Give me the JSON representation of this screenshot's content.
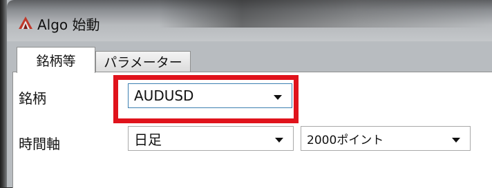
{
  "window": {
    "title": "Algo 始動"
  },
  "tabs": [
    {
      "label": "銘柄等",
      "active": true
    },
    {
      "label": "パラメーター",
      "active": false
    }
  ],
  "form": {
    "symbol_label": "銘柄",
    "symbol_value": "AUDUSD",
    "timeframe_label": "時間軸",
    "timeframe_value": "日足",
    "bars_value": "2000ポイント"
  },
  "colors": {
    "highlight": "#e0131c",
    "icon": "#c0392b"
  }
}
